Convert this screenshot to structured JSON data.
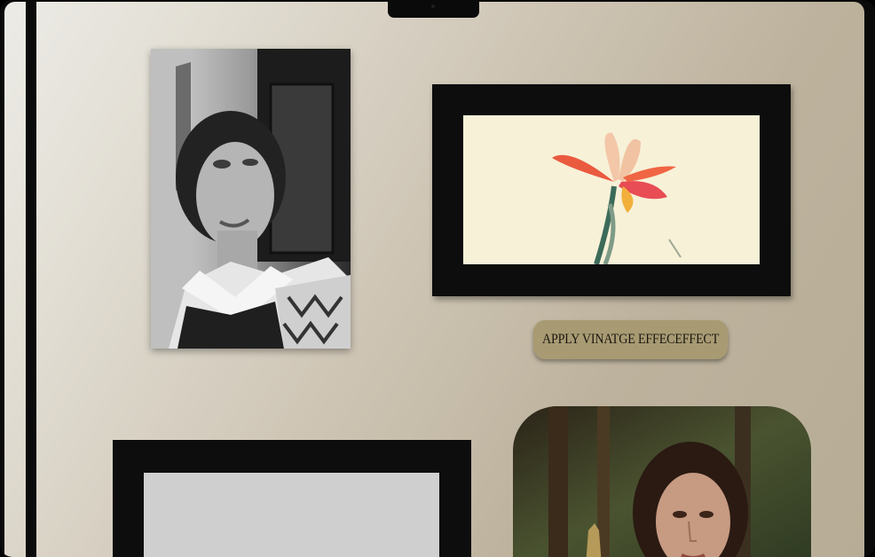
{
  "gallery": {
    "vintage_button_label": "APPLY VINATGE EFFECEFFECT"
  },
  "images": {
    "portrait": {
      "name": "portrait-woman-bw"
    },
    "flower": {
      "name": "red-iris-flower"
    },
    "empty_frame": {
      "name": "empty-frame"
    },
    "woman_forest": {
      "name": "woman-in-forest"
    }
  },
  "colors": {
    "background_start": "#ecebe6",
    "background_end": "#b7ad96",
    "frame": "#0d0d0d",
    "button": "#a89b73",
    "mat_cream": "#f7f1d8",
    "mat_gray": "#cfcfcf"
  }
}
